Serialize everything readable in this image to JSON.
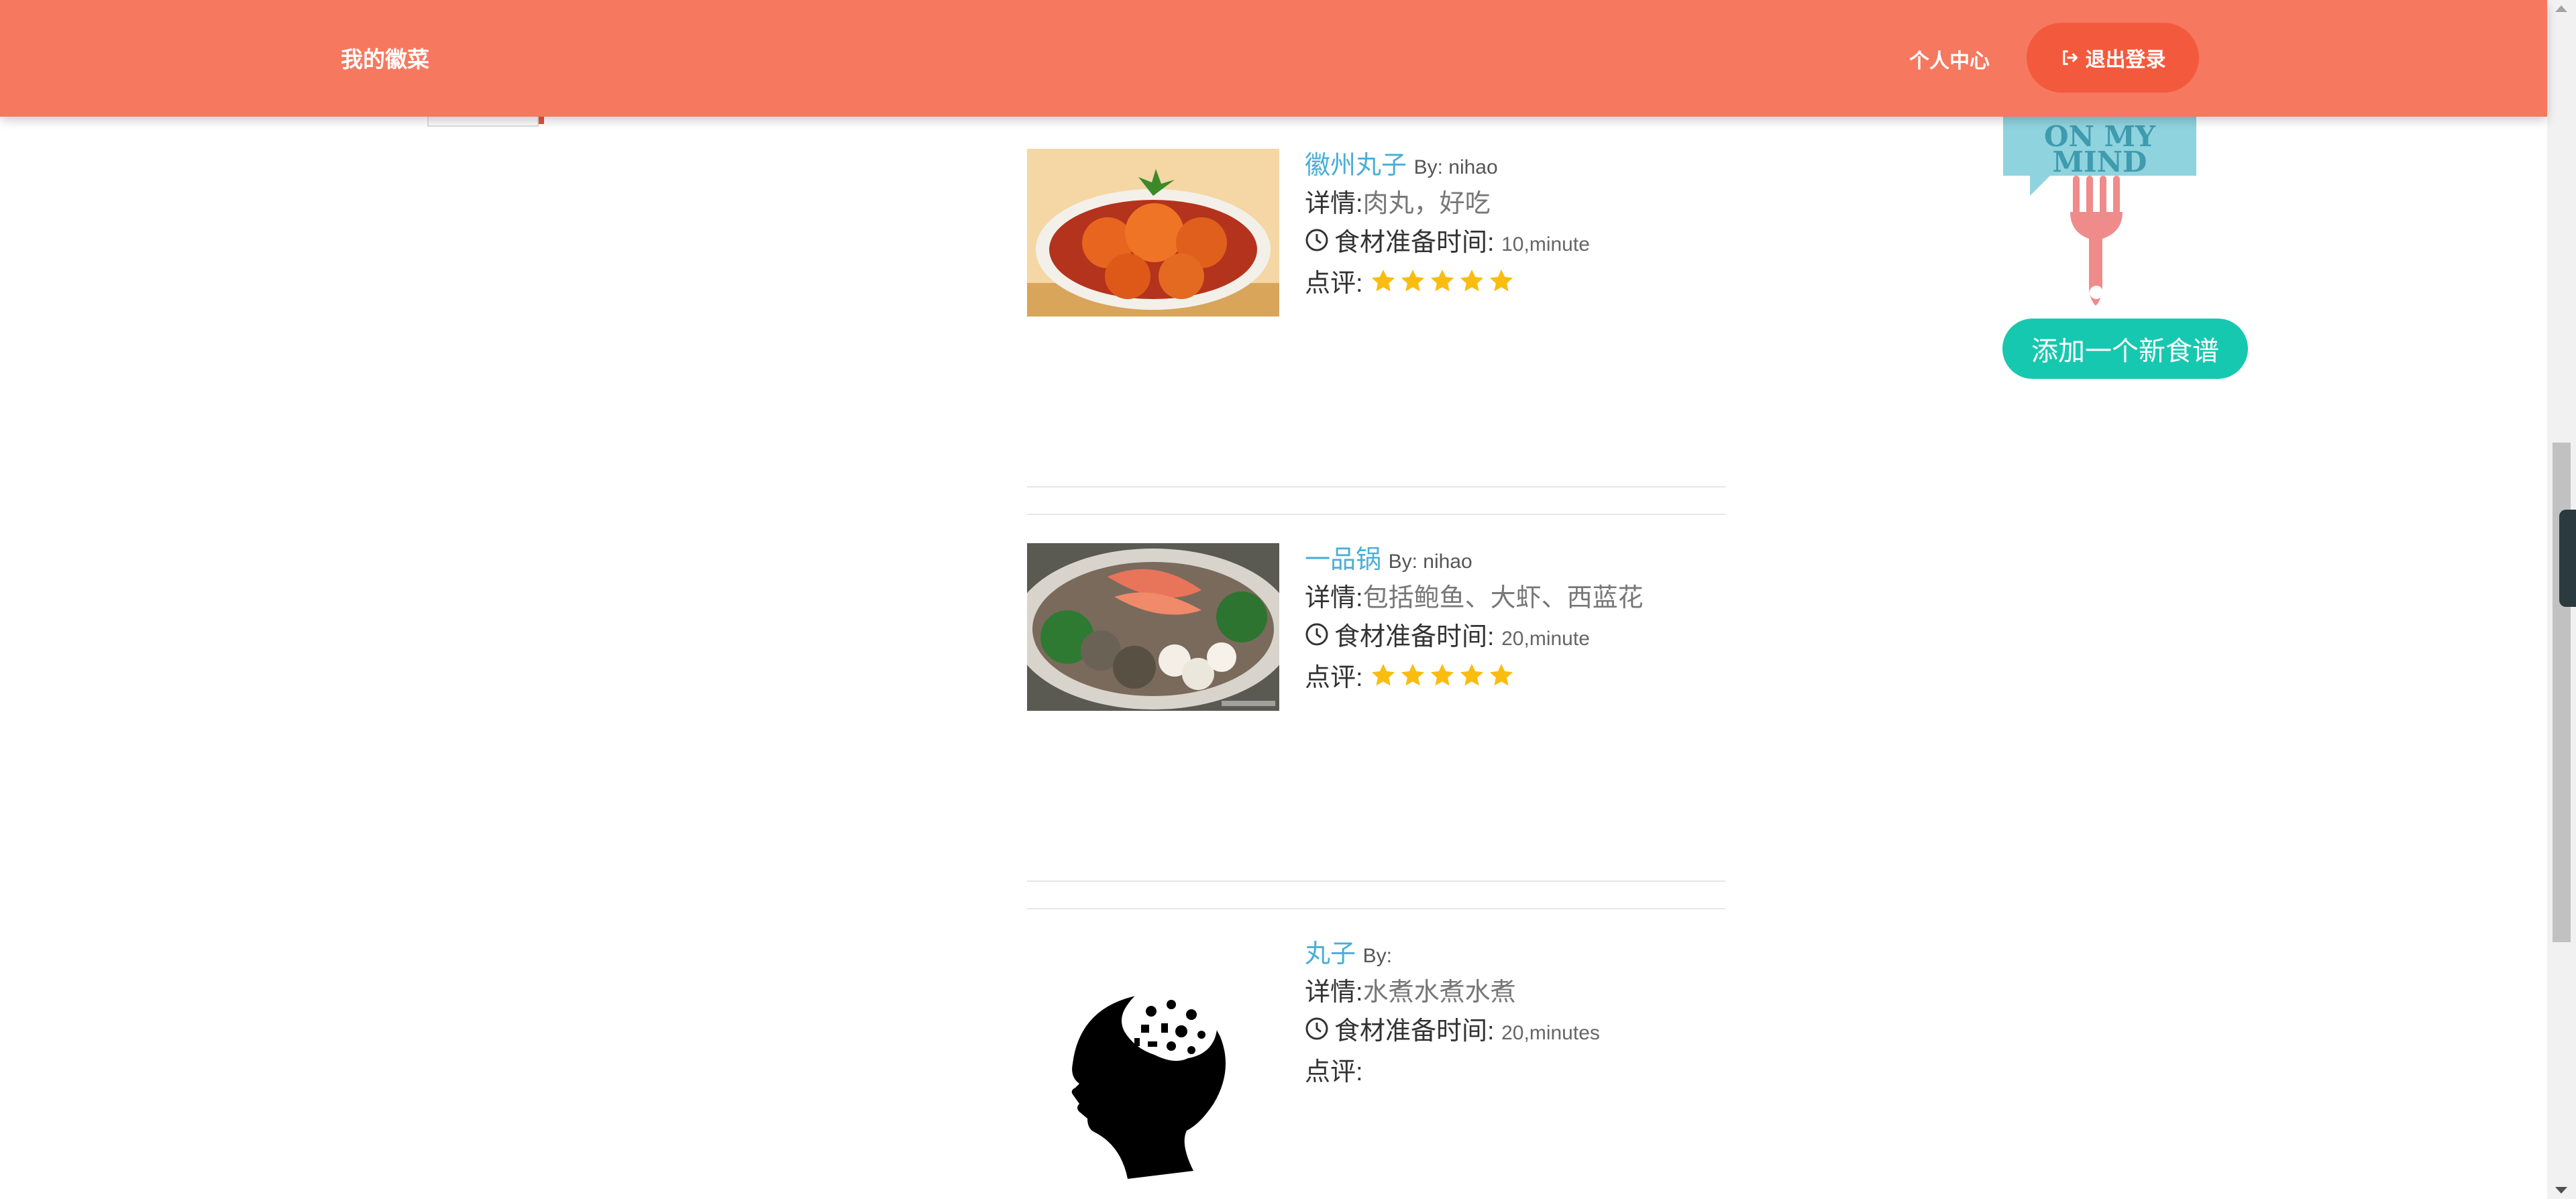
{
  "navbar": {
    "brand": "我的徽菜",
    "personal_center": "个人中心",
    "logout": "退出登录"
  },
  "recipes": [
    {
      "name": "徽州丸子",
      "by": "By: nihao",
      "detail_label": "详情:",
      "detail": "肉丸，好吃",
      "prep_label": "食材准备时间:",
      "prep": "10,minute",
      "review_label": "点评:",
      "rating": 5
    },
    {
      "name": "一品锅",
      "by": "By: nihao",
      "detail_label": "详情:",
      "detail": "包括鲍鱼、大虾、西蓝花",
      "prep_label": "食材准备时间:",
      "prep": "20,minute",
      "review_label": "点评:",
      "rating": 5
    },
    {
      "name": "丸子",
      "by": "By:",
      "detail_label": "详情:",
      "detail": "水煮水煮水煮",
      "prep_label": "食材准备时间:",
      "prep": "20,minutes",
      "review_label": "点评:",
      "rating": 0
    }
  ],
  "sidebar": {
    "image_text_line1": "ON MY",
    "image_text_line2": "MIND",
    "add_button": "添加一个新食谱"
  },
  "colors": {
    "navbar": "#f6785f",
    "logout_button": "#f35a3d",
    "link": "#4aaed6",
    "star": "#f9bd12",
    "add_button": "#17c8b0"
  }
}
